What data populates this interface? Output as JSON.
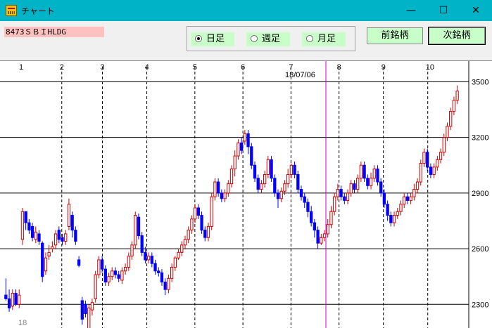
{
  "window": {
    "title": "チャート",
    "minimize_glyph": "—",
    "maximize_glyph": "☐",
    "close_glyph": "✕",
    "icon": "chart-app-icon"
  },
  "stock": {
    "label": "8473ＳＢＩHLDG"
  },
  "period": {
    "options": [
      "日足",
      "週足",
      "月足"
    ],
    "selected": "日足"
  },
  "buttons": {
    "prev": "前銘柄",
    "next": "次銘柄"
  },
  "colors": {
    "up": "#d00000",
    "down": "#0000ff",
    "cursor": "#cc00cc",
    "price_label_bg": "#ffc0c0",
    "button_bg": "#c8ffc8"
  },
  "chart_data": {
    "type": "candlestick",
    "month_labels": [
      "1",
      "2",
      "3",
      "4",
      "5",
      "6",
      "7",
      "8",
      "9",
      "10"
    ],
    "year_label": "18",
    "cursor_date": "18/07/06",
    "y_ticks": [
      3500,
      3200,
      2900,
      2600,
      2300
    ],
    "ylim": [
      2180,
      3600
    ],
    "grid": true,
    "candles": [
      [
        2350,
        2330,
        2440,
        2320
      ],
      [
        2330,
        2280,
        2380,
        2260
      ],
      [
        2290,
        2360,
        2380,
        2270
      ],
      [
        2360,
        2300,
        2380,
        2290
      ],
      [
        2300,
        2350,
        2380,
        2280
      ],
      [
        2650,
        2800,
        2820,
        2620
      ],
      [
        2800,
        2740,
        2790,
        2700
      ],
      [
        2740,
        2700,
        2760,
        2680
      ],
      [
        2720,
        2660,
        2740,
        2640
      ],
      [
        2650,
        2690,
        2720,
        2630
      ],
      [
        2680,
        2640,
        2700,
        2620
      ],
      [
        2630,
        2450,
        2640,
        2420
      ],
      [
        2480,
        2550,
        2580,
        2460
      ],
      [
        2560,
        2580,
        2620,
        2540
      ],
      [
        2600,
        2610,
        2640,
        2580
      ],
      [
        2620,
        2680,
        2700,
        2600
      ],
      [
        2700,
        2650,
        2720,
        2630
      ],
      [
        2660,
        2640,
        2680,
        2620
      ],
      [
        2640,
        2680,
        2700,
        2620
      ],
      [
        2720,
        2840,
        2870,
        2700
      ],
      [
        2780,
        2700,
        2800,
        2660
      ],
      [
        2700,
        2640,
        2720,
        2620
      ],
      [
        2540,
        2510,
        2560,
        2500
      ],
      [
        2320,
        2220,
        2340,
        2190
      ],
      [
        2300,
        2250,
        2320,
        2230
      ],
      [
        2170,
        2280,
        2300,
        2150
      ],
      [
        2270,
        2310,
        2330,
        2240
      ],
      [
        2330,
        2460,
        2480,
        2310
      ],
      [
        2460,
        2540,
        2560,
        2440
      ],
      [
        2540,
        2490,
        2560,
        2470
      ],
      [
        2490,
        2420,
        2510,
        2400
      ],
      [
        2420,
        2450,
        2470,
        2400
      ],
      [
        2450,
        2480,
        2500,
        2430
      ],
      [
        2480,
        2460,
        2500,
        2440
      ],
      [
        2460,
        2440,
        2480,
        2420
      ],
      [
        2430,
        2480,
        2500,
        2410
      ],
      [
        2480,
        2500,
        2520,
        2460
      ],
      [
        2500,
        2560,
        2580,
        2480
      ],
      [
        2560,
        2620,
        2640,
        2540
      ],
      [
        2620,
        2780,
        2800,
        2600
      ],
      [
        2770,
        2670,
        2790,
        2650
      ],
      [
        2670,
        2580,
        2690,
        2560
      ],
      [
        2580,
        2540,
        2610,
        2520
      ],
      [
        2540,
        2560,
        2580,
        2520
      ],
      [
        2560,
        2520,
        2580,
        2500
      ],
      [
        2520,
        2480,
        2540,
        2460
      ],
      [
        2480,
        2470,
        2500,
        2450
      ],
      [
        2470,
        2420,
        2490,
        2400
      ],
      [
        2420,
        2380,
        2440,
        2350
      ],
      [
        2380,
        2440,
        2460,
        2360
      ],
      [
        2440,
        2500,
        2520,
        2420
      ],
      [
        2500,
        2550,
        2560,
        2480
      ],
      [
        2550,
        2580,
        2600,
        2540
      ],
      [
        2580,
        2620,
        2640,
        2560
      ],
      [
        2620,
        2650,
        2670,
        2600
      ],
      [
        2650,
        2700,
        2720,
        2630
      ],
      [
        2700,
        2760,
        2780,
        2680
      ],
      [
        2760,
        2820,
        2840,
        2740
      ],
      [
        2820,
        2780,
        2840,
        2760
      ],
      [
        2780,
        2700,
        2800,
        2680
      ],
      [
        2700,
        2660,
        2720,
        2640
      ],
      [
        2660,
        2720,
        2740,
        2640
      ],
      [
        2720,
        2880,
        2900,
        2700
      ],
      [
        2880,
        2960,
        2980,
        2860
      ],
      [
        2960,
        2900,
        2980,
        2880
      ],
      [
        2900,
        2870,
        2920,
        2850
      ],
      [
        2870,
        2900,
        2920,
        2850
      ],
      [
        2900,
        2950,
        2970,
        2880
      ],
      [
        2950,
        3030,
        3050,
        2930
      ],
      [
        3030,
        3100,
        3130,
        2990
      ],
      [
        3100,
        3170,
        3190,
        3080
      ],
      [
        3170,
        3130,
        3200,
        3110
      ],
      [
        3180,
        3220,
        3240,
        3160
      ],
      [
        3220,
        3150,
        3240,
        3110
      ],
      [
        3150,
        3050,
        3170,
        3030
      ],
      [
        3050,
        2980,
        3070,
        2960
      ],
      [
        2980,
        2920,
        3000,
        2900
      ],
      [
        2920,
        2950,
        2970,
        2900
      ],
      [
        2950,
        3000,
        3020,
        2930
      ],
      [
        3000,
        3080,
        3100,
        2980
      ],
      [
        3080,
        2980,
        3100,
        2960
      ],
      [
        2980,
        2900,
        3000,
        2880
      ],
      [
        2900,
        2870,
        2920,
        2820
      ],
      [
        2870,
        2910,
        2930,
        2850
      ],
      [
        2910,
        2950,
        2970,
        2890
      ],
      [
        2950,
        3000,
        3030,
        2930
      ],
      [
        3000,
        3050,
        3060,
        2980
      ],
      [
        3050,
        3000,
        3070,
        2980
      ],
      [
        3000,
        2920,
        3020,
        2900
      ],
      [
        2920,
        2880,
        2940,
        2860
      ],
      [
        2880,
        2850,
        2900,
        2820
      ],
      [
        2850,
        2800,
        2870,
        2770
      ],
      [
        2800,
        2740,
        2830,
        2720
      ],
      [
        2740,
        2700,
        2760,
        2660
      ],
      [
        2700,
        2630,
        2720,
        2600
      ],
      [
        2630,
        2660,
        2680,
        2620
      ],
      [
        2660,
        2680,
        2700,
        2640
      ],
      [
        2680,
        2730,
        2760,
        2660
      ],
      [
        2730,
        2800,
        2830,
        2710
      ],
      [
        2800,
        2880,
        2900,
        2780
      ],
      [
        2880,
        2920,
        2950,
        2860
      ],
      [
        2920,
        2880,
        2940,
        2860
      ],
      [
        2880,
        2860,
        2900,
        2840
      ],
      [
        2860,
        2900,
        2920,
        2840
      ],
      [
        2900,
        2950,
        2970,
        2880
      ],
      [
        2950,
        2920,
        2970,
        2900
      ],
      [
        2920,
        2980,
        3000,
        2900
      ],
      [
        2980,
        3050,
        3070,
        2960
      ],
      [
        3050,
        2980,
        3070,
        2960
      ],
      [
        2980,
        2940,
        3000,
        2920
      ],
      [
        2940,
        2980,
        3010,
        2920
      ],
      [
        2980,
        3030,
        3050,
        2960
      ],
      [
        3030,
        2960,
        3050,
        2940
      ],
      [
        2960,
        2900,
        2980,
        2880
      ],
      [
        2900,
        2840,
        2920,
        2820
      ],
      [
        2840,
        2780,
        2860,
        2750
      ],
      [
        2780,
        2740,
        2800,
        2720
      ],
      [
        2740,
        2780,
        2800,
        2720
      ],
      [
        2780,
        2800,
        2820,
        2760
      ],
      [
        2800,
        2840,
        2860,
        2780
      ],
      [
        2840,
        2880,
        2900,
        2820
      ],
      [
        2880,
        2860,
        2900,
        2840
      ],
      [
        2860,
        2880,
        2900,
        2840
      ],
      [
        2880,
        2920,
        2950,
        2860
      ],
      [
        2920,
        2960,
        2980,
        2900
      ],
      [
        2960,
        3060,
        3080,
        2940
      ],
      [
        3060,
        3120,
        3140,
        3040
      ],
      [
        3120,
        3040,
        3140,
        3020
      ],
      [
        3040,
        3000,
        3060,
        2980
      ],
      [
        3000,
        3040,
        3060,
        2980
      ],
      [
        3040,
        3080,
        3100,
        3020
      ],
      [
        3080,
        3120,
        3140,
        3060
      ],
      [
        3120,
        3200,
        3220,
        3100
      ],
      [
        3200,
        3260,
        3280,
        3180
      ],
      [
        3260,
        3340,
        3360,
        3240
      ],
      [
        3340,
        3400,
        3420,
        3320
      ],
      [
        3400,
        3450,
        3480,
        3380
      ]
    ]
  }
}
